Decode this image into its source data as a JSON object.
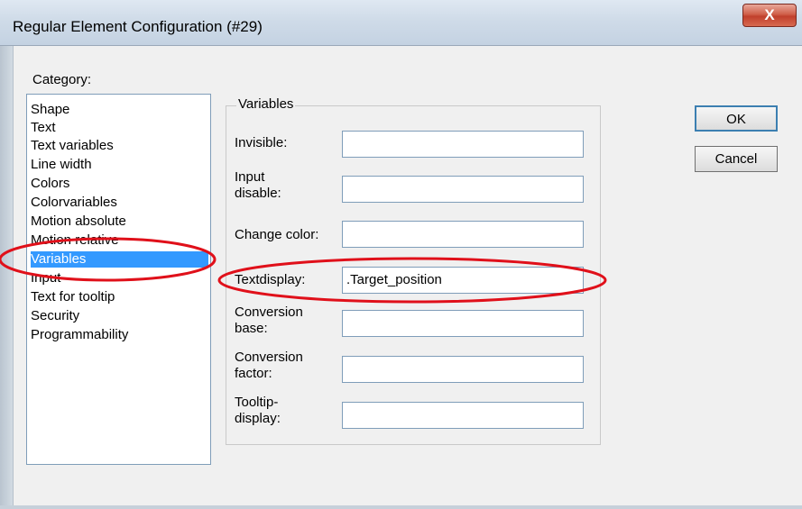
{
  "window": {
    "title": "Regular Element Configuration (#29)",
    "close_symbol": "X"
  },
  "category": {
    "label": "Category:",
    "items": [
      "Shape",
      "Text",
      "Text variables",
      "Line width",
      "Colors",
      "Colorvariables",
      "Motion absolute",
      "Motion relative",
      "Variables",
      "Input",
      "Text for tooltip",
      "Security",
      "Programmability"
    ],
    "selected": "Variables"
  },
  "variables": {
    "group_label": "Variables",
    "fields": [
      {
        "label": "Invisible:",
        "value": ""
      },
      {
        "label": "Input disable:",
        "value": ""
      },
      {
        "label": "Change color:",
        "value": ""
      },
      {
        "label": "Textdisplay:",
        "value": ".Target_position"
      },
      {
        "label": "Conversion base:",
        "value": ""
      },
      {
        "label": "Conversion factor:",
        "value": ""
      },
      {
        "label": "Tooltip-display:",
        "value": ""
      }
    ]
  },
  "buttons": {
    "ok": "OK",
    "cancel": "Cancel"
  },
  "colors": {
    "selection": "#3399ff",
    "annotation": "#e0101a"
  }
}
